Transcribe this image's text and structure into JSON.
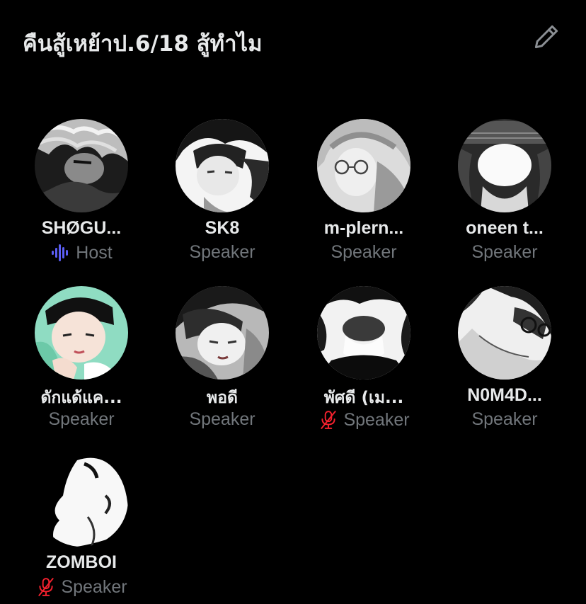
{
  "header": {
    "title": "คืนสู้เหย้าป.6/18 สู้ทำไม",
    "edit_icon": "pencil-icon"
  },
  "colors": {
    "background": "#000000",
    "name_text": "#e7e9ea",
    "role_text": "#71767b",
    "host_wave": "#5b5ef4",
    "muted": "#f4212e"
  },
  "participants": [
    {
      "name": "SHØGU...",
      "role": "Host",
      "status_icon": "audio-wave-icon",
      "avatar": "avatar-grayscale"
    },
    {
      "name": "SK8",
      "role": "Speaker",
      "status_icon": "",
      "avatar": "avatar-grayscale"
    },
    {
      "name": "m-plern...",
      "role": "Speaker",
      "status_icon": "",
      "avatar": "avatar-grayscale"
    },
    {
      "name": "oneen t...",
      "role": "Speaker",
      "status_icon": "",
      "avatar": "avatar-grayscale"
    },
    {
      "name": "ดักแด้แค...",
      "role": "Speaker",
      "status_icon": "",
      "avatar": "avatar-color"
    },
    {
      "name": "พอดี",
      "role": "Speaker",
      "status_icon": "",
      "avatar": "avatar-grayscale"
    },
    {
      "name": "พัศดี (เม...",
      "role": "Speaker",
      "status_icon": "mic-muted-icon",
      "avatar": "avatar-grayscale"
    },
    {
      "name": "N0M4D...",
      "role": "Speaker",
      "status_icon": "",
      "avatar": "avatar-grayscale"
    },
    {
      "name": "ZOMBOI",
      "role": "Speaker",
      "status_icon": "mic-muted-icon",
      "avatar": "avatar-grayscale"
    }
  ]
}
